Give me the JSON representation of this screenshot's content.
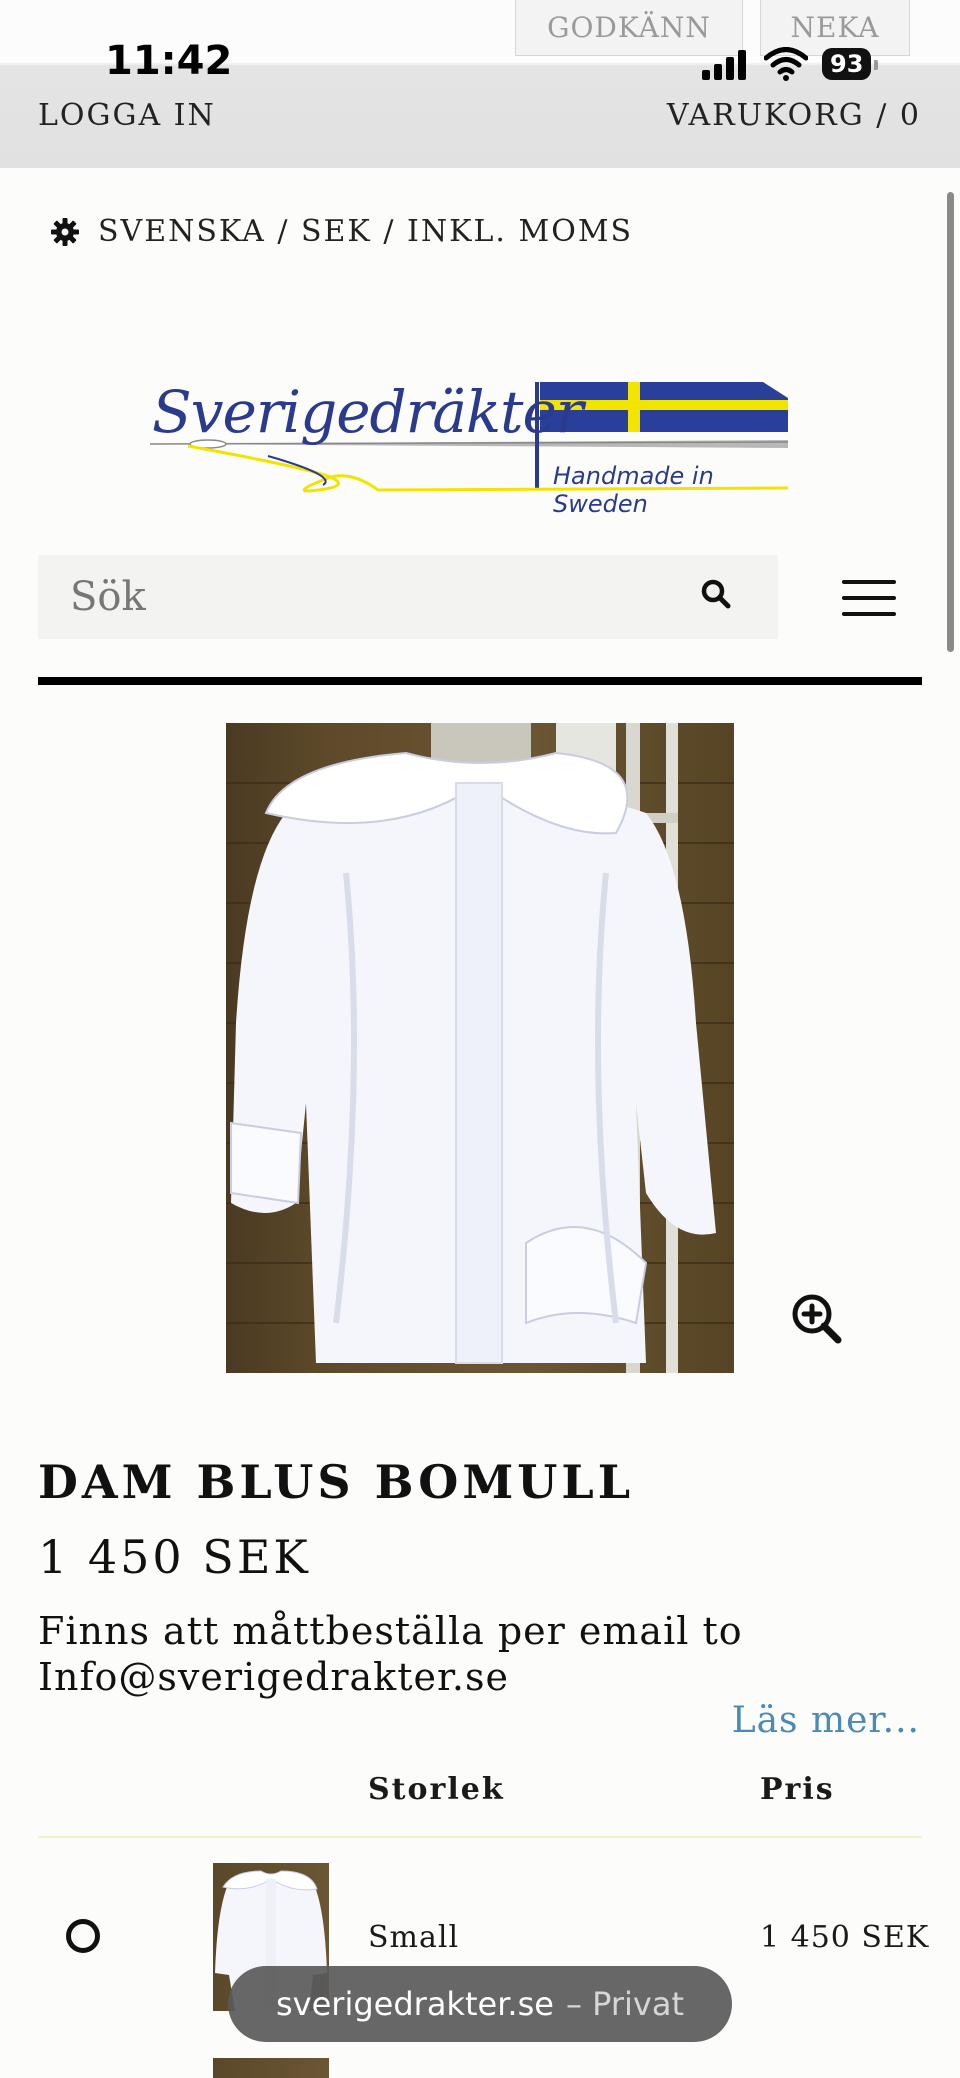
{
  "cookie_banner": {
    "accept_label": "GODKÄNN",
    "deny_label": "NEKA"
  },
  "status_bar": {
    "time": "11:42",
    "battery": "93"
  },
  "header": {
    "login_label": "LOGGA IN",
    "cart_label": "VARUKORG / 0"
  },
  "locale": {
    "label": "SVENSKA / SEK / INKL. MOMS"
  },
  "logo": {
    "brand": "Sverigedräkter",
    "tagline": "Handmade in Sweden"
  },
  "search": {
    "placeholder": "Sök"
  },
  "product": {
    "title": "DAM BLUS BOMULL",
    "price": "1 450 SEK",
    "description": "Finns att måttbeställa per email to Info@sverigedrakter.se",
    "read_more": "Läs mer..."
  },
  "variants": {
    "headers": {
      "size": "Storlek",
      "price": "Pris"
    },
    "rows": [
      {
        "size": "Small",
        "price": "1 450 SEK"
      }
    ]
  },
  "browser": {
    "domain": "sverigedrakter.se",
    "mode": "– Privat"
  },
  "colors": {
    "brand_blue": "#2a3a8c",
    "flag_yellow": "#f3e400",
    "link_blue": "#4a8ab5"
  }
}
